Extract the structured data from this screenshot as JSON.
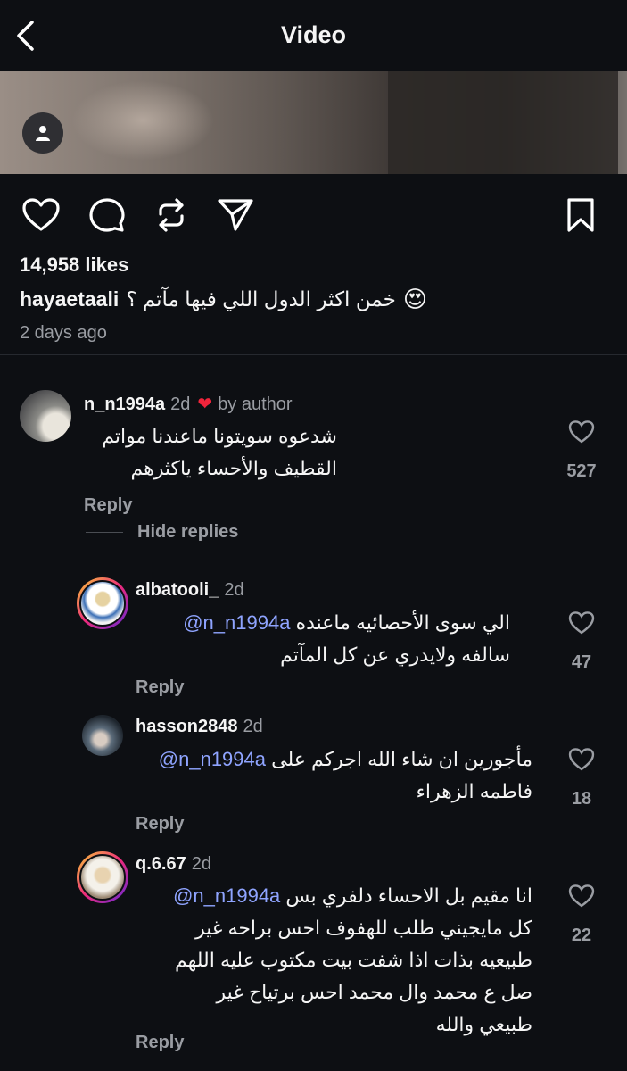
{
  "header": {
    "title": "Video",
    "back_icon": "chevron-left-icon"
  },
  "post": {
    "likes": "14,958 likes",
    "username": "hayaetaali",
    "caption": "خمن اكثر الدول اللي فيها مآتم ؟",
    "caption_emoji": "😍",
    "time_ago": "2 days ago"
  },
  "comments": [
    {
      "username": "n_n1994a",
      "time": "2d",
      "liked_by_author": "by author",
      "lines": [
        "شدعوه سويتونا ماعندنا مواتم",
        "القطيف والأحساء ياكثرهم"
      ],
      "likes": "527",
      "reply_label": "Reply",
      "hide_replies_label": "Hide replies"
    }
  ],
  "replies": [
    {
      "username": "albatooli_",
      "time": "2d",
      "mention": "@n_n1994a",
      "line1": "الي سوى الأحصائيه ماعنده",
      "line2": "سالفه ولايدري عن كل المآتم",
      "likes": "47",
      "reply_label": "Reply"
    },
    {
      "username": "hasson2848",
      "time": "2d",
      "mention": "@n_n1994a",
      "line1": "مأجورين ان شاء الله اجركم على",
      "line2": "فاطمه الزهراء",
      "likes": "18",
      "reply_label": "Reply"
    },
    {
      "username": "q.6.67",
      "time": "2d",
      "mention": "@n_n1994a",
      "line1": "انا مقيم بل الاحساء دلفري بس",
      "line2": "كل مايجيني طلب للهفوف احس براحه غير",
      "line3": "طبيعيه بذات اذا شفت بيت مكتوب عليه اللهم",
      "line4": "صل ع محمد وال محمد احس برتياح غير",
      "line5": "طبيعي والله",
      "likes": "22",
      "reply_label": "Reply"
    }
  ],
  "colors": {
    "background": "#0d0f13",
    "mention": "#8fa4ff",
    "heart": "#f1243b",
    "muted": "#9a9da3"
  }
}
